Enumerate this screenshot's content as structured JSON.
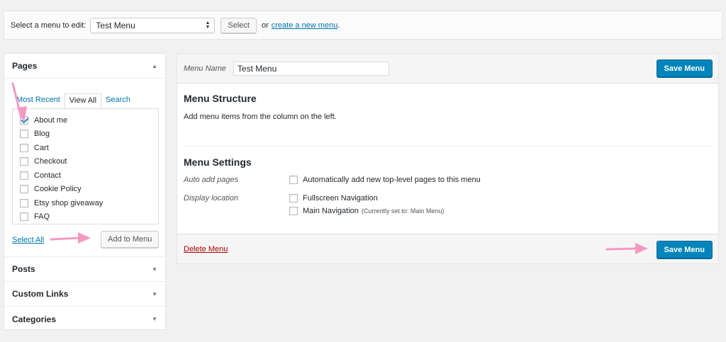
{
  "topbar": {
    "label": "Select a menu to edit:",
    "selected_menu": "Test Menu",
    "select_button": "Select",
    "or_text": "or",
    "create_link": "create a new menu",
    "period": "."
  },
  "sidebar": {
    "pages": {
      "title": "Pages",
      "tabs": [
        "Most Recent",
        "View All",
        "Search"
      ],
      "items": [
        {
          "label": "About me",
          "checked": true
        },
        {
          "label": "Blog",
          "checked": false
        },
        {
          "label": "Cart",
          "checked": false
        },
        {
          "label": "Checkout",
          "checked": false
        },
        {
          "label": "Contact",
          "checked": false
        },
        {
          "label": "Cookie Policy",
          "checked": false
        },
        {
          "label": "Etsy shop giveaway",
          "checked": false
        },
        {
          "label": "FAQ",
          "checked": false
        }
      ],
      "select_all": "Select All",
      "add_button": "Add to Menu"
    },
    "sections": [
      "Posts",
      "Custom Links",
      "Categories"
    ]
  },
  "main": {
    "menu_name_label": "Menu Name",
    "menu_name_value": "Test Menu",
    "save_button": "Save Menu",
    "structure_title": "Menu Structure",
    "structure_desc": "Add menu items from the column on the left.",
    "settings_title": "Menu Settings",
    "auto_add_label": "Auto add pages",
    "auto_add_option": "Automatically add new top-level pages to this menu",
    "display_location_label": "Display location",
    "locations": [
      {
        "label": "Fullscreen Navigation",
        "note": ""
      },
      {
        "label": "Main Navigation",
        "note": "(Currently set to: Main Menu)"
      }
    ],
    "delete_link": "Delete Menu"
  },
  "colors": {
    "primary": "#0085ba",
    "link": "#0073aa",
    "delete": "#aa0000",
    "annotation_arrow": "#f49ac2"
  },
  "icons": {
    "select_arrows": "updown-icon",
    "section_toggle": "triangle-icon",
    "annotation": "arrow-icon"
  }
}
